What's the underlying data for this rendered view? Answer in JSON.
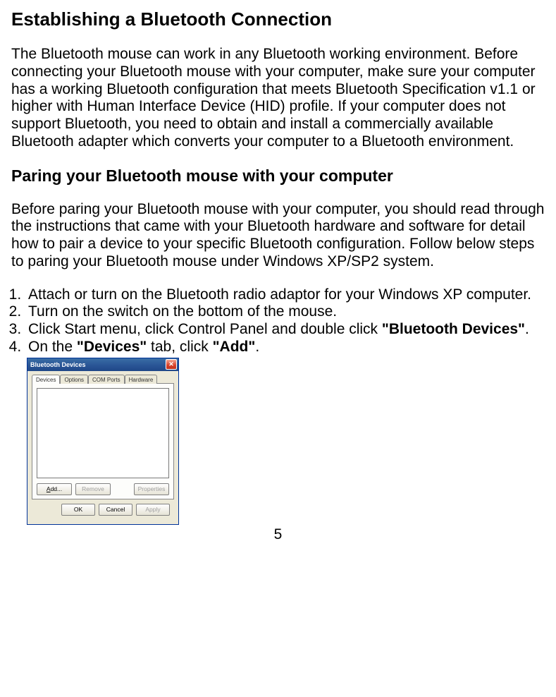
{
  "heading1": "Establishing a Bluetooth Connection",
  "para1": "The Bluetooth mouse can work in any Bluetooth working environment. Before connecting your Bluetooth mouse with your computer, make sure your computer has a working Bluetooth configuration that meets Bluetooth Specification v1.1 or higher with Human Interface Device (HID) profile. If your computer does not support Bluetooth, you need to obtain and install a commercially available Bluetooth adapter which converts your computer to a Bluetooth environment.",
  "heading2": "Paring your Bluetooth mouse with your computer",
  "para2": "Before paring your Bluetooth mouse with your computer, you should read through the instructions that came with your Bluetooth hardware and software for detail how to pair a device to your specific Bluetooth configuration. Follow below steps to paring your Bluetooth mouse under Windows XP/SP2 system.",
  "steps": {
    "s1": "Attach or turn on the Bluetooth radio adaptor for your Windows XP computer.",
    "s2": "Turn on the switch on the bottom of the mouse.",
    "s3a": "Click Start menu, click Control Panel and double click ",
    "s3b": "\"Bluetooth Devices\"",
    "s3c": ".",
    "s4a": "On the ",
    "s4b": "\"Devices\"",
    "s4c": " tab, click ",
    "s4d": "\"Add\"",
    "s4e": "."
  },
  "dialog": {
    "title": "Bluetooth Devices",
    "tabs": {
      "devices": "Devices",
      "options": "Options",
      "com": "COM Ports",
      "hw": "Hardware"
    },
    "btns": {
      "add": "Add...",
      "remove": "Remove",
      "properties": "Properties",
      "ok": "OK",
      "cancel": "Cancel",
      "apply": "Apply"
    }
  },
  "page_number": "5"
}
